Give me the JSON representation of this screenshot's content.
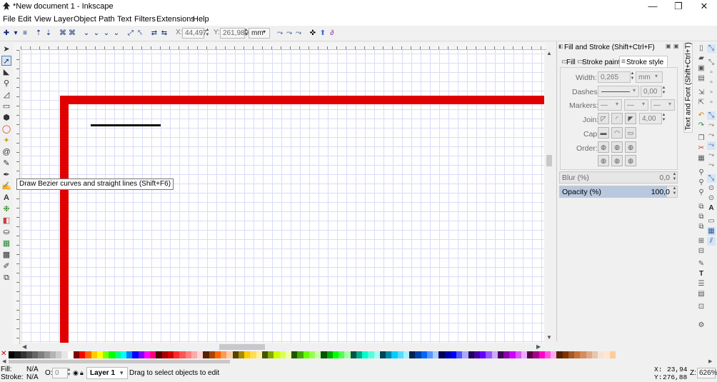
{
  "window": {
    "title": "*New document 1 - Inkscape",
    "minimize": "—",
    "maximize": "❐",
    "close": "✕"
  },
  "menu": [
    "File",
    "Edit",
    "View",
    "Layer",
    "Object",
    "Path",
    "Text",
    "Filters",
    "Extensions",
    "Help"
  ],
  "controls": {
    "x_label": "X:",
    "x_value": "44,497",
    "y_label": "Y:",
    "y_value": "261,989",
    "unit": "mm"
  },
  "tooltip": "Draw Bezier curves and straight lines (Shift+F6)",
  "dock": {
    "title": "Fill and Stroke (Shift+Ctrl+F)",
    "tabs": [
      "Fill",
      "Stroke paint",
      "Stroke style"
    ],
    "width_label": "Width:",
    "width_value": "0,265",
    "width_unit": "mm",
    "dashes_label": "Dashes:",
    "dashes_offset": "0,00",
    "markers_label": "Markers:",
    "join_label": "Join:",
    "miter_value": "4,00",
    "cap_label": "Cap:",
    "order_label": "Order:",
    "blur_label": "Blur (%)",
    "blur_value": "0,0",
    "opacity_label": "Opacity (%)",
    "opacity_value": "100,0",
    "opacity_fraction": 1.0,
    "side_tab": "Text and Font (Shift+Ctrl+T)"
  },
  "status": {
    "fill_label": "Fill:",
    "fill_value": "N/A",
    "stroke_label": "Stroke:",
    "stroke_value": "N/A",
    "o_label": "O:",
    "o_value": "0",
    "layer": "Layer 1",
    "message": "Drag to select objects to edit",
    "x_label": "X:",
    "x_value": "23,94",
    "y_label": "Y:",
    "y_value": "276,88",
    "z_label": "Z:",
    "zoom": "626%"
  },
  "colors": {
    "accent_red": "#e00000",
    "selection_tool": "#5a7fb5"
  }
}
